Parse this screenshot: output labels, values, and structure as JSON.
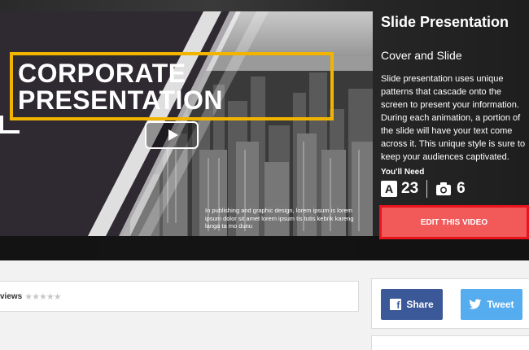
{
  "video": {
    "title_line1": "CORPORATE",
    "title_line2": "PRESENTATION",
    "lorem": "In publishing and graphic design, lorem ipsum is lorem ipsum dolor sit amet lorem ipsum tis tutis kebrik kareng langa ta mo dunu",
    "play_icon": "play-icon"
  },
  "info": {
    "title": "Slide Presentation",
    "subtitle": "Cover and Slide",
    "description_lines": [
      "Slide presentation uses unique",
      "patterns that cascade onto the",
      "screen to present your information.",
      "During each animation, a portion of",
      "the slide will have your text come",
      "across it. This unique style is sure to",
      "keep your audiences captivated."
    ],
    "need_label": "You'll Need",
    "text_count": "23",
    "image_count": "6",
    "text_icon_glyph": "A",
    "edit_label": "EDIT THIS VIDEO"
  },
  "reviews": {
    "label": "views",
    "stars": "★★★★★"
  },
  "share": {
    "facebook_label": "Share",
    "twitter_label": "Tweet",
    "facebook_icon_glyph": "f"
  },
  "colors": {
    "accent_yellow": "#f3b400",
    "edit_red": "#f25a5a",
    "edit_border": "#e8141e",
    "facebook": "#3b5998",
    "twitter": "#55acee"
  }
}
